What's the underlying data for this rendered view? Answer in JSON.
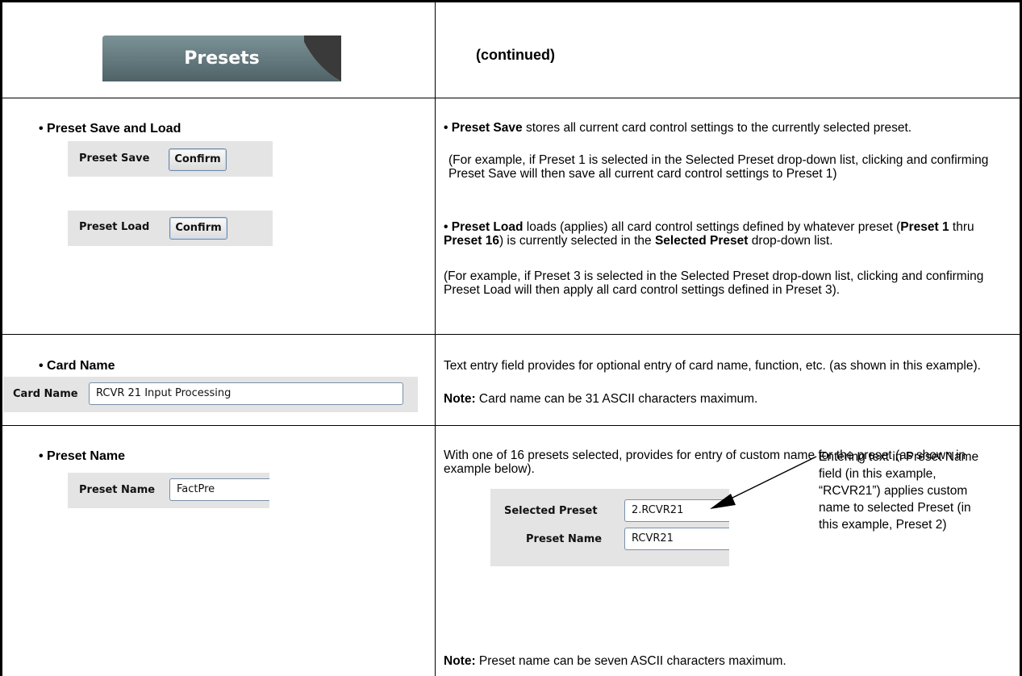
{
  "header": {
    "tab_title": "Presets",
    "continued": "(continued)"
  },
  "rows": {
    "save_load": {
      "heading": "• Preset Save and Load",
      "save_label": "Preset Save",
      "load_label": "Preset Load",
      "confirm_label": "Confirm",
      "desc1_bold": "• Preset Save",
      "desc1_rest": " stores all current card control settings to the currently selected preset.",
      "desc2": "(For example, if Preset 1 is selected in the Selected Preset drop-down list, clicking and confirming Preset Save will then save all current card control settings to Preset 1)",
      "desc3_bold1": "• Preset Load",
      "desc3_rest1": " loads (applies) all card control settings defined by whatever preset (",
      "desc3_bold2": "Preset 1",
      "desc3_rest2": " thru ",
      "desc3_bold3": "Preset 16",
      "desc3_rest3": ") is currently selected in the ",
      "desc3_bold4": "Selected Preset",
      "desc3_rest4": " drop-down list.",
      "desc4": "(For example, if Preset 3 is selected in the Selected Preset drop-down list, clicking and confirming Preset Load will then apply all card control settings defined in Preset 3)."
    },
    "card_name": {
      "heading": "• Card Name",
      "label": "Card Name",
      "value": "RCVR 21 Input Processing",
      "desc": "Text entry field provides for optional entry of card name, function, etc. (as shown in this example).",
      "note_bold": "Note:",
      "note_rest": " Card name can be 31 ASCII characters maximum."
    },
    "preset_name": {
      "heading": "• Preset Name",
      "label": "Preset Name",
      "value": "FactPre",
      "desc": "With one of 16 presets selected, provides for entry of custom name for the preset (as shown in example below).",
      "selected_preset_label": "Selected Preset",
      "selected_preset_value": "2.RCVR21",
      "example_name_label": "Preset Name",
      "example_name_value": "RCVR21",
      "callout": "Entering text in Preset Name field (in this example, “RCVR21”) applies custom name to selected Preset (in this example, Preset 2)",
      "note_bold": "Note:",
      "note_rest": " Preset name can be seven ASCII characters maximum."
    }
  },
  "colors": {
    "tab_bg": "#5f7478",
    "panel_bg": "#e4e4e4",
    "button_border": "#6e87a4"
  }
}
